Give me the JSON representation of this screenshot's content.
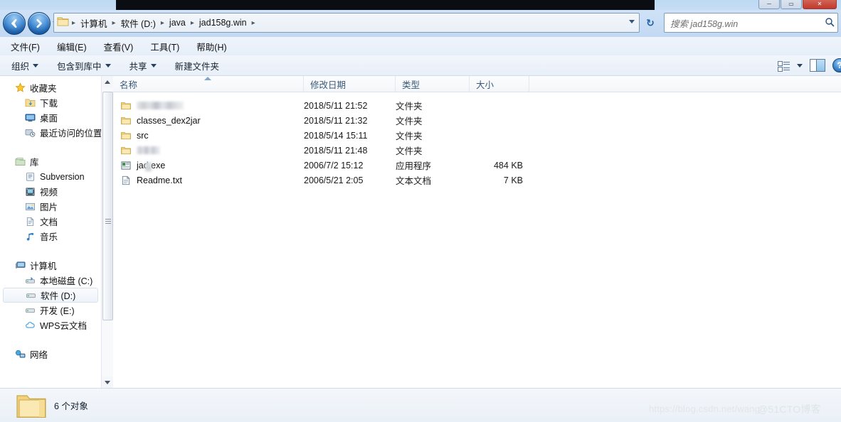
{
  "window": {
    "controls": [
      {
        "name": "minimize",
        "glyph": "─"
      },
      {
        "name": "maximize",
        "glyph": "▭"
      },
      {
        "name": "close",
        "glyph": "✕"
      }
    ]
  },
  "address": {
    "crumbs": [
      "计算机",
      "软件 (D:)",
      "java",
      "jad158g.win"
    ],
    "separator": "▸",
    "refresh_glyph": "↻"
  },
  "search": {
    "placeholder": "搜索 jad158g.win",
    "icon": "search-icon"
  },
  "menu": {
    "items": [
      "文件(F)",
      "编辑(E)",
      "查看(V)",
      "工具(T)",
      "帮助(H)"
    ]
  },
  "toolbar": {
    "items": [
      {
        "label": "组织",
        "caret": true
      },
      {
        "label": "包含到库中",
        "caret": true
      },
      {
        "label": "共享",
        "caret": true
      },
      {
        "label": "新建文件夹",
        "caret": false
      }
    ],
    "help_glyph": "?"
  },
  "sidebar": {
    "groups": [
      {
        "root": {
          "label": "收藏夹",
          "icon": "star-icon"
        },
        "children": [
          {
            "label": "下载",
            "icon": "download-folder-icon"
          },
          {
            "label": "桌面",
            "icon": "desktop-icon"
          },
          {
            "label": "最近访问的位置",
            "icon": "recent-places-icon"
          }
        ]
      },
      {
        "root": {
          "label": "库",
          "icon": "library-icon"
        },
        "children": [
          {
            "label": "Subversion",
            "icon": "subversion-icon"
          },
          {
            "label": "视频",
            "icon": "video-icon"
          },
          {
            "label": "图片",
            "icon": "pictures-icon"
          },
          {
            "label": "文档",
            "icon": "documents-icon"
          },
          {
            "label": "音乐",
            "icon": "music-icon"
          }
        ]
      },
      {
        "root": {
          "label": "计算机",
          "icon": "computer-icon"
        },
        "children": [
          {
            "label": "本地磁盘 (C:)",
            "icon": "system-drive-icon",
            "selected": false
          },
          {
            "label": "软件 (D:)",
            "icon": "drive-icon",
            "selected": true
          },
          {
            "label": "开发 (E:)",
            "icon": "drive-icon",
            "selected": false
          },
          {
            "label": "WPS云文档",
            "icon": "cloud-icon",
            "selected": false
          }
        ]
      },
      {
        "root": {
          "label": "网络",
          "icon": "network-icon"
        },
        "children": []
      }
    ]
  },
  "filelist": {
    "columns": [
      {
        "label": "名称",
        "sorted": true,
        "sort_dir": "asc"
      },
      {
        "label": "修改日期",
        "sorted": false
      },
      {
        "label": "类型",
        "sorted": false
      },
      {
        "label": "大小",
        "sorted": false
      }
    ],
    "rows": [
      {
        "name": "",
        "redacted": true,
        "redacted_width": 66,
        "icon": "folder-icon",
        "date": "2018/5/11 21:52",
        "type": "文件夹",
        "size": ""
      },
      {
        "name": "classes_dex2jar",
        "redacted": false,
        "icon": "folder-icon",
        "date": "2018/5/11 21:32",
        "type": "文件夹",
        "size": ""
      },
      {
        "name": "src",
        "redacted": false,
        "icon": "folder-icon",
        "date": "2018/5/14 15:11",
        "type": "文件夹",
        "size": ""
      },
      {
        "name": "",
        "redacted": true,
        "redacted_width": 33,
        "icon": "folder-icon",
        "date": "2018/5/11 21:48",
        "type": "文件夹",
        "size": ""
      },
      {
        "name": "jad.exe",
        "redacted": false,
        "partial_smudge": true,
        "icon": "application-icon",
        "date": "2006/7/2 15:12",
        "type": "应用程序",
        "size": "484 KB"
      },
      {
        "name": "Readme.txt",
        "redacted": false,
        "icon": "text-file-icon",
        "date": "2006/5/21 2:05",
        "type": "文本文档",
        "size": "7 KB"
      }
    ]
  },
  "status": {
    "text": "6 个对象",
    "icon": "folder-large-icon"
  },
  "watermarks": {
    "csdn": "https://blog.csdn.net/wang",
    "ctoblog": "@51CTO博客"
  },
  "colors": {
    "glass_blue": "#c2d9f2",
    "toolbar": "#eef4fb",
    "accent": "#3f86cf",
    "close_red": "#c0392b",
    "header_text": "#3b5a7a"
  }
}
